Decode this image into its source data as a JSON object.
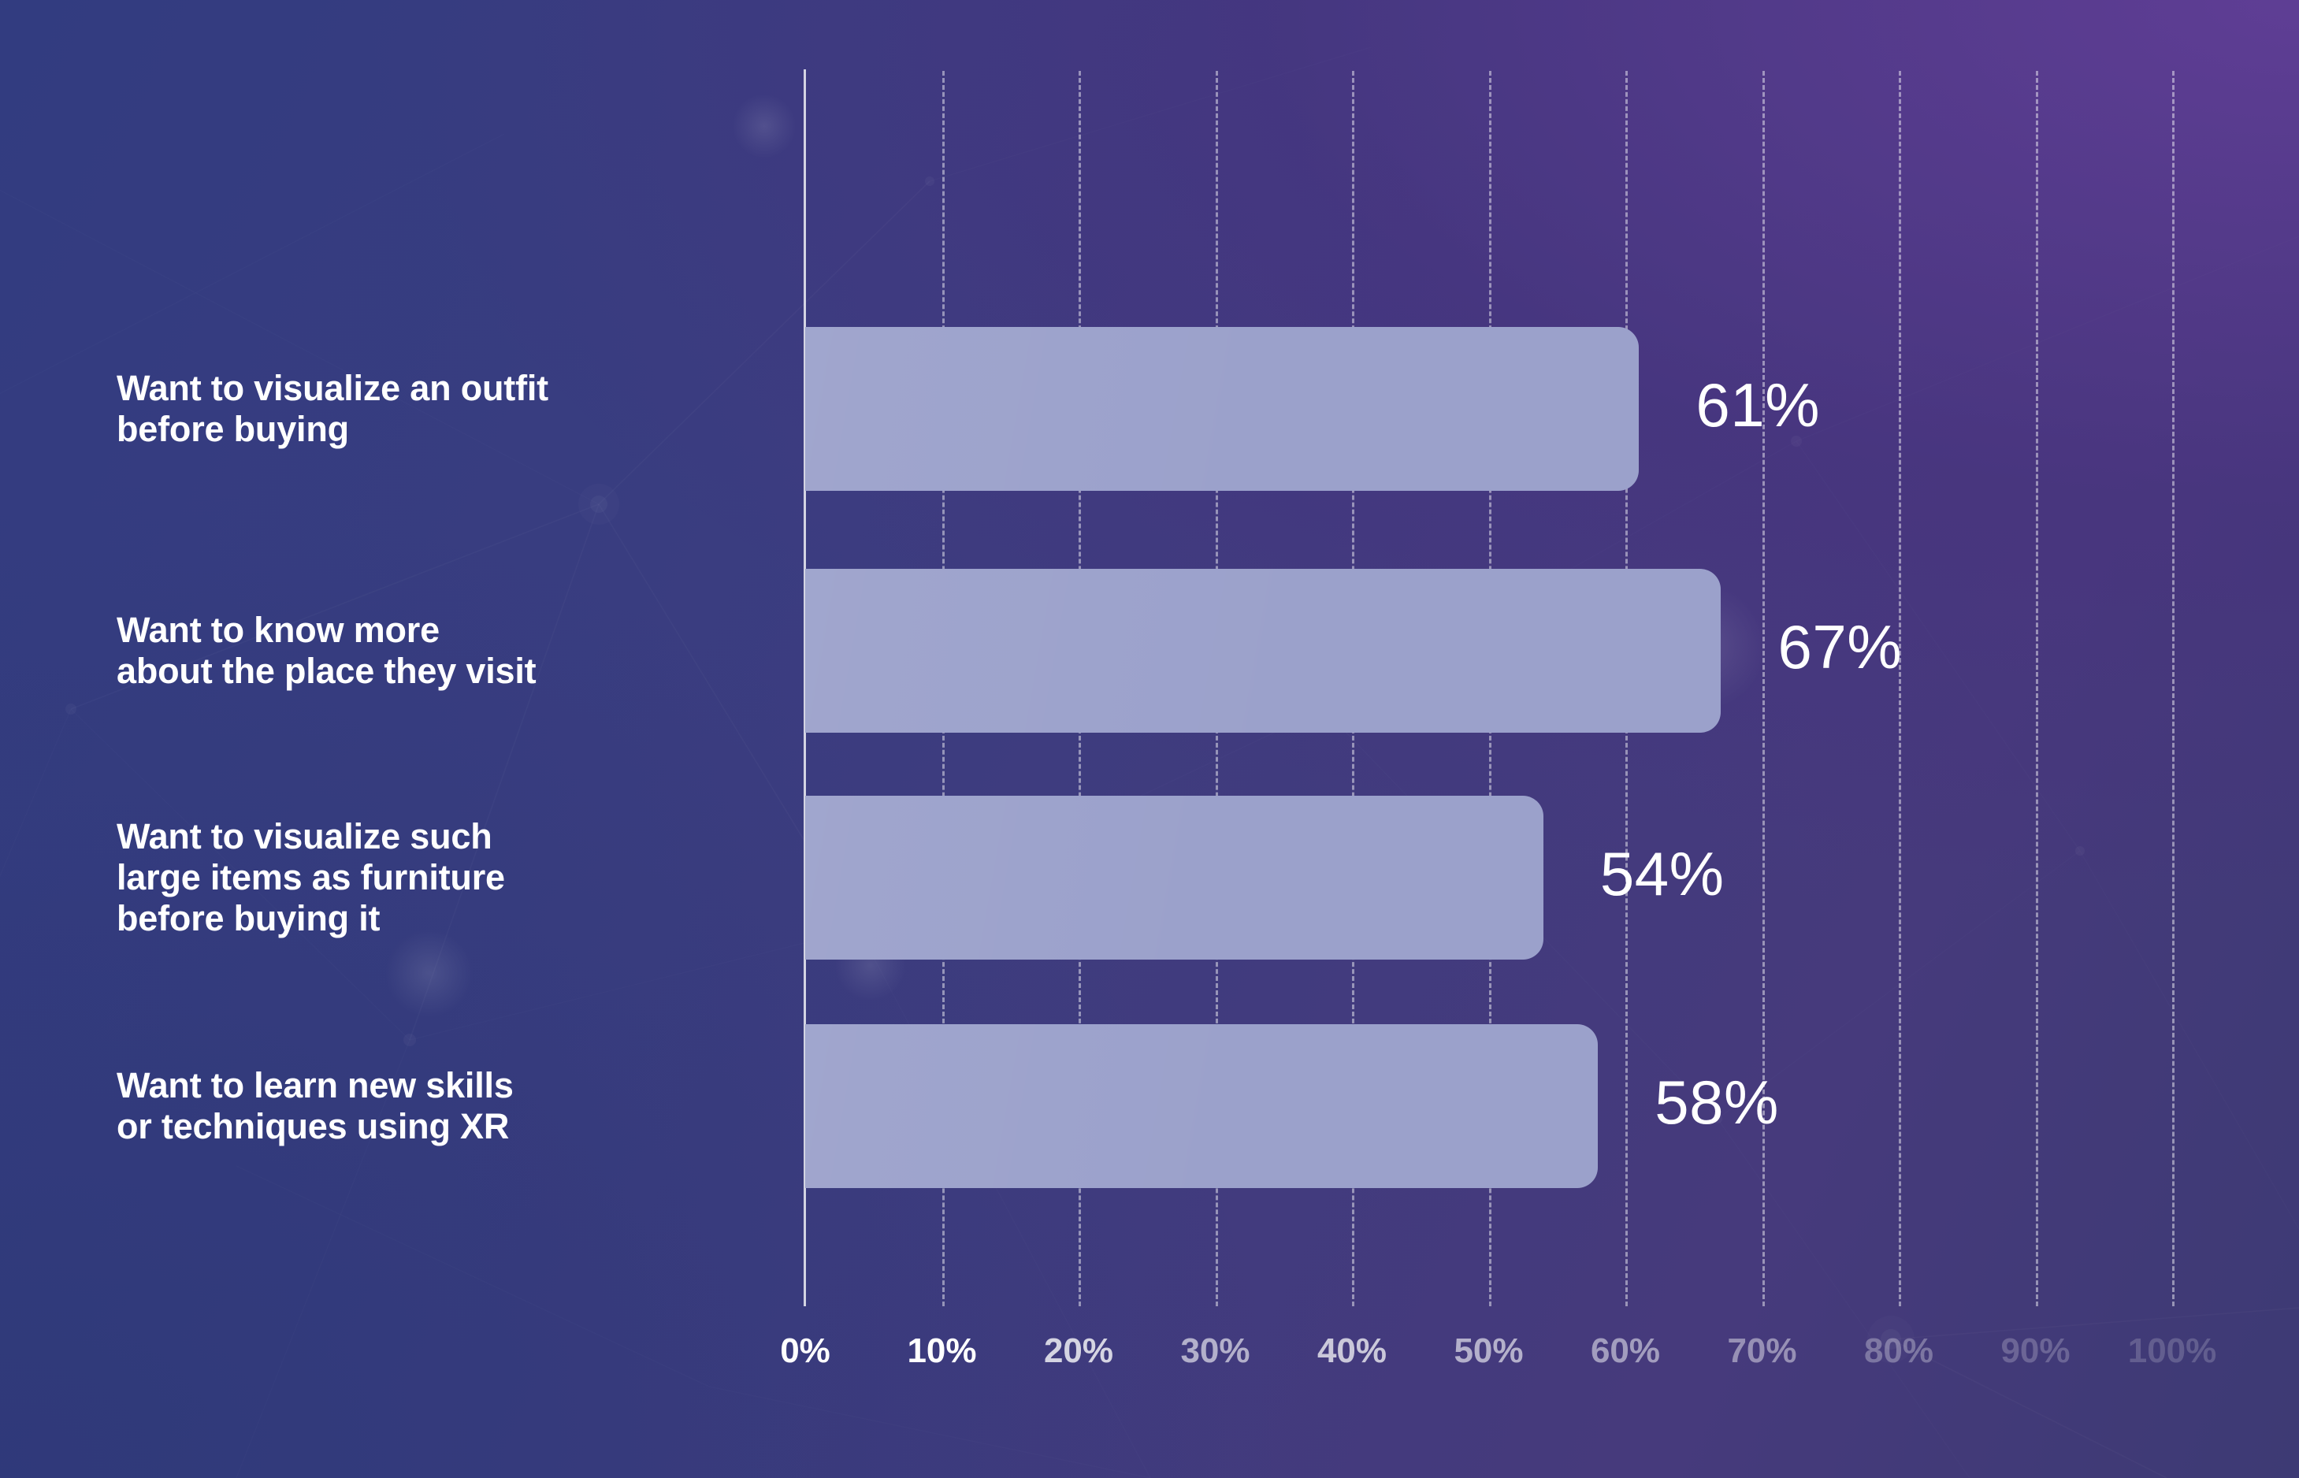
{
  "chart_data": {
    "type": "bar",
    "orientation": "horizontal",
    "title": "",
    "subtitle": "",
    "xlabel": "",
    "ylabel": "",
    "xlim": [
      0,
      100
    ],
    "grid": true,
    "legend": null,
    "categories": [
      "Want to visualize an outfit\nbefore buying",
      "Want to know more\nabout the place they visit",
      "Want to visualize such\nlarge items as furniture\nbefore buying it",
      "Want to learn new skills\nor techniques using XR"
    ],
    "values": [
      61,
      67,
      54,
      58
    ],
    "value_labels": [
      "61%",
      "67%",
      "54%",
      "58%"
    ],
    "tick_labels": [
      "0%",
      "10%",
      "20%",
      "30%",
      "40%",
      "50%",
      "60%",
      "70%",
      "80%",
      "90%",
      "100%"
    ],
    "tick_values": [
      0,
      10,
      20,
      30,
      40,
      50,
      60,
      70,
      80,
      90,
      100
    ],
    "tick_opacities": [
      1.0,
      1.0,
      0.78,
      0.6,
      0.72,
      0.6,
      0.5,
      0.44,
      0.3,
      0.22,
      0.18
    ],
    "colors": {
      "bar": "#9ba1cb",
      "label_text": "#ffffff",
      "value_text": "#ffffff",
      "axis": "#ffffff",
      "grid": "#ffffff",
      "background_start": "#323c80",
      "background_end": "#463a7c"
    }
  }
}
